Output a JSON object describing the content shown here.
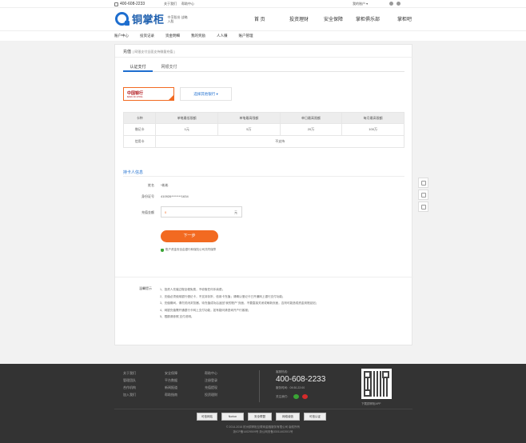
{
  "topbar": {
    "phone": "400-608-2233",
    "links": [
      "关于我们",
      "帮助中心"
    ],
    "account": "我的账户 ▾"
  },
  "header": {
    "brand": "铜掌柜",
    "slogan": "中孚股份 战略入股",
    "nav": [
      "首 页",
      "投资理财",
      "安全保障",
      "掌柜俱乐部",
      "掌柜吧"
    ]
  },
  "subnav": [
    "账户中心",
    "投资记录",
    "资金明细",
    "我的奖励",
    "人人赚",
    "账户管理"
  ],
  "card": {
    "title": "充值",
    "title_hint": "[ 网银支付全面支持微量充值 ]",
    "tabs": [
      "认证支付",
      "网银支付"
    ],
    "bank": {
      "name": "中国银行",
      "sub": "BANK OF CHINA"
    },
    "other_bank": "选择其他银行 ▾",
    "table": {
      "headers": [
        "卡种",
        "单笔最低限额",
        "单笔最高限额",
        "单日最高限额",
        "每月最高限额"
      ],
      "rows": [
        [
          "借记卡",
          "1元",
          "5万",
          "20万",
          "100万"
        ],
        [
          "信用卡",
          "不支持"
        ]
      ]
    },
    "section_title": "持卡人信息",
    "fields": {
      "name_label": "姓名",
      "name_value": "*彬彬",
      "id_label": "身份证号",
      "id_value": "410926********1634",
      "amount_label": "充值金额",
      "amount_placeholder": "0",
      "amount_unit": "元"
    },
    "next_button": "下一步",
    "safe_text": "账户资金安全由银行和保险公司共同保障",
    "tips_title": "温馨提示",
    "tips": [
      "1、投资人充值过程全程免费，不收取任何手续费；",
      "2、充值必须使用银行借记卡，不支持存折、信用卡充值；请确认借记卡已开通网上银行支付功能；",
      "3、充值期间，请勿关闭浏览器，待充值成功后返回“我的账户”页面，不要直接关闭或刷新页面，否则可能造成资金到账延迟；",
      "4、网银充值需开通银行卡网上支付功能，如有疑问请咨询开户行客服；",
      "5、限额请参照 支付说明。"
    ]
  },
  "footer": {
    "col1": [
      "关于我们",
      "管理团队",
      "合作机构",
      "加入我们"
    ],
    "col2": [
      "安全保障",
      "平台数据",
      "新闻报道",
      "帮助指南"
    ],
    "col3": [
      "帮助中心",
      "注册登录",
      "充值提现",
      "投资理财"
    ],
    "hotline_label": "客服热线：",
    "phone": "400-608-2233",
    "time": "服务时间：09:30-22:00",
    "follow": "关注我们：",
    "qr_label": "下载铜掌柜APP",
    "badges": [
      "可信网站",
      "Norton",
      "安全联盟",
      "网络诚信",
      "可信认证"
    ],
    "copyright": "© 2014-2016 杭州铜掌柜互联网金融服务有限公司 版权所有",
    "icp": "浙ICP备14029509号    浙公网安备33011402001号"
  }
}
